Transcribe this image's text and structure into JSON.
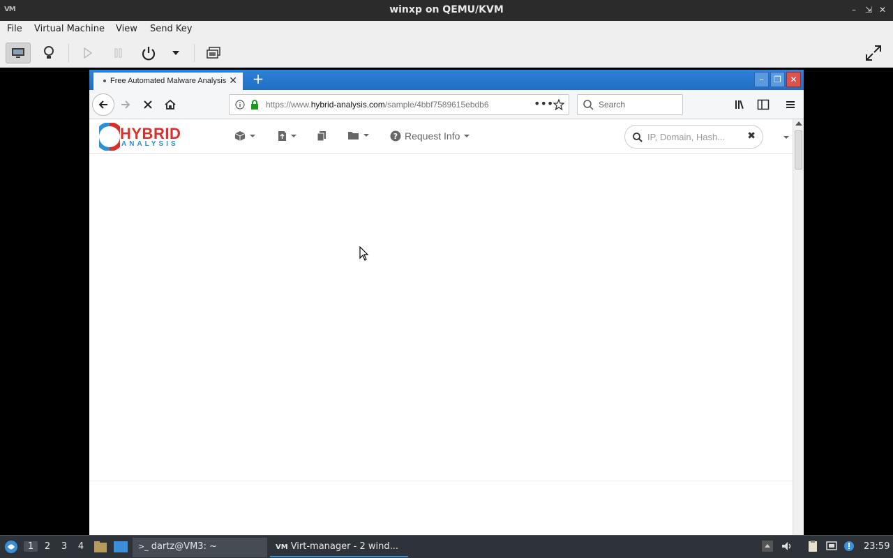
{
  "host_window": {
    "title": "winxp on QEMU/KVM",
    "logo": "VM",
    "menu": [
      "File",
      "Virtual Machine",
      "View",
      "Send Key"
    ],
    "toolbar_icons": [
      "monitor-icon",
      "lightbulb-icon",
      "play-icon",
      "pause-icon",
      "power-icon",
      "chevron-down-icon",
      "screenshot-icon",
      "fullscreen-icon"
    ]
  },
  "browser": {
    "tab_title": "Free Automated Malware Analysis",
    "new_tab": "+",
    "url_prefix": "https://www.",
    "url_domain": "hybrid-analysis.com",
    "url_rest": "/sample/4bbf7589615ebdb6",
    "search_placeholder": "Search"
  },
  "site": {
    "logo_main": "HYBRID",
    "logo_sub": "ANALYSIS",
    "nav_request": "Request Info",
    "search_placeholder": "IP, Domain, Hash..."
  },
  "taskbar": {
    "workspaces": [
      "1",
      "2",
      "3",
      "4"
    ],
    "active_workspace": "1",
    "task1": "dartz@VM3: ~",
    "task2": "Virt-manager - 2 wind...",
    "clock": "23:59"
  },
  "colors": {
    "firefox_titlebar": "#1f6ec4",
    "logo_red": "#d9302c",
    "logo_blue": "#2a8fd6"
  }
}
